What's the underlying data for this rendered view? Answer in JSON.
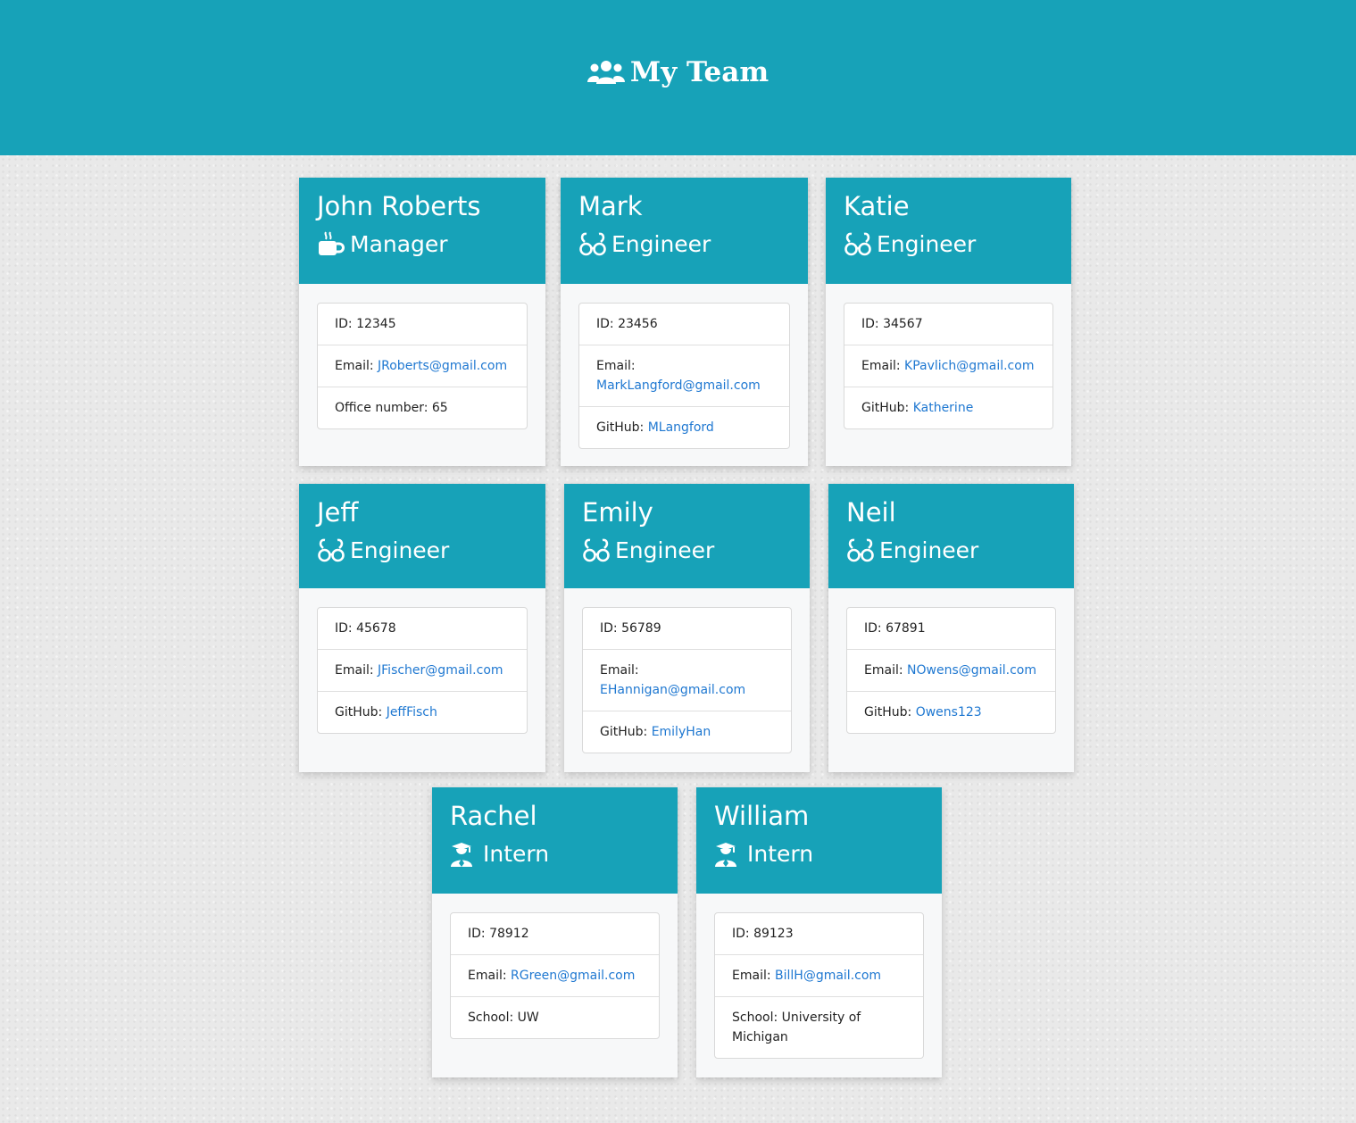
{
  "header": {
    "title": "My Team",
    "icon": "users-icon"
  },
  "labels": {
    "id": "ID: ",
    "email": "Email: ",
    "office": "Office number: ",
    "github": "GitHub: ",
    "school": "School: "
  },
  "colors": {
    "header_bg": "#17a2b8",
    "link": "#1f78d1",
    "card_bg": "#f7f8f9"
  },
  "employees": [
    {
      "name": "John Roberts",
      "role": "Manager",
      "icon": "coffee-icon",
      "id": "12345",
      "email": "JRoberts@gmail.com",
      "extra": "65"
    },
    {
      "name": "Mark",
      "role": "Engineer",
      "icon": "glasses-icon",
      "id": "23456",
      "email": "MarkLangford@gmail.com",
      "extra": "MLangford"
    },
    {
      "name": "Katie",
      "role": "Engineer",
      "icon": "glasses-icon",
      "id": "34567",
      "email": "KPavlich@gmail.com",
      "extra": "Katherine"
    },
    {
      "name": "Jeff",
      "role": "Engineer",
      "icon": "glasses-icon",
      "id": "45678",
      "email": "JFischer@gmail.com",
      "extra": "JeffFisch"
    },
    {
      "name": "Emily",
      "role": "Engineer",
      "icon": "glasses-icon",
      "id": "56789",
      "email": "EHannigan@gmail.com",
      "extra": "EmilyHan"
    },
    {
      "name": "Neil",
      "role": "Engineer",
      "icon": "glasses-icon",
      "id": "67891",
      "email": "NOwens@gmail.com",
      "extra": "Owens123"
    },
    {
      "name": "Rachel",
      "role": "Intern",
      "icon": "graduate-icon",
      "id": "78912",
      "email": "RGreen@gmail.com",
      "extra": "UW"
    },
    {
      "name": "William",
      "role": "Intern",
      "icon": "graduate-icon",
      "id": "89123",
      "email": "BillH@gmail.com",
      "extra": "University of Michigan"
    }
  ]
}
